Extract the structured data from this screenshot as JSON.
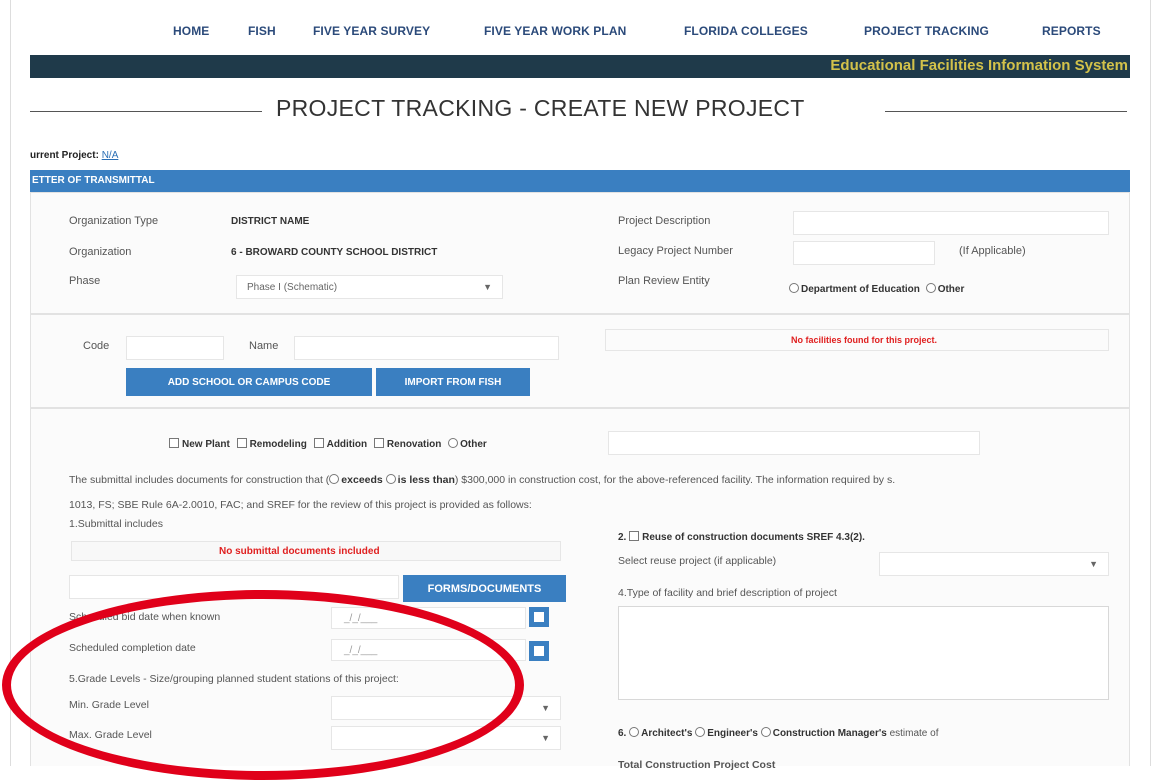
{
  "nav": {
    "items": [
      "HOME",
      "FISH",
      "FIVE YEAR SURVEY",
      "FIVE YEAR WORK PLAN",
      "FLORIDA COLLEGES",
      "PROJECT TRACKING",
      "REPORTS"
    ]
  },
  "banner": {
    "text": "Educational Facilities Information System"
  },
  "page": {
    "title": "PROJECT TRACKING - CREATE NEW PROJECT"
  },
  "current_project": {
    "label": "urrent Project:",
    "value": "N/A"
  },
  "section": {
    "title": "ETTER OF TRANSMITTAL"
  },
  "org": {
    "type_label": "Organization Type",
    "type_value": "DISTRICT NAME",
    "org_label": "Organization",
    "org_value": "6 - BROWARD COUNTY SCHOOL DISTRICT",
    "phase_label": "Phase",
    "phase_value": "Phase I (Schematic)",
    "desc_label": "Project Description",
    "legacy_label": "Legacy Project Number",
    "legacy_hint": "(If Applicable)",
    "review_label": "Plan Review Entity",
    "review_options": [
      "Department of Education",
      "Other"
    ]
  },
  "facility": {
    "code_label": "Code",
    "name_label": "Name",
    "add_button": "ADD SCHOOL OR CAMPUS CODE",
    "import_button": "IMPORT FROM FISH",
    "empty_message": "No facilities found for this project."
  },
  "construction": {
    "types": [
      "New Plant",
      "Remodeling",
      "Addition",
      "Renovation",
      "Other"
    ],
    "text_prefix": "The submittal includes documents for construction that (",
    "exceeds": "exceeds",
    "less_than": "is less than",
    "text_suffix": ") $300,000 in construction cost, for the above-referenced facility. The information required by s.",
    "text_line2": "1013, FS; SBE Rule 6A-2.0010, FAC; and SREF for the review of this project is provided as follows:"
  },
  "submittal": {
    "label": "1.Submittal includes",
    "empty": "No submittal documents included",
    "forms_button": "FORMS/DOCUMENTS",
    "bid_label": "Scheduled bid date when known",
    "completion_label": "Scheduled completion date",
    "date_placeholder": "_/_/___",
    "grade_label": "5.Grade Levels - Size/grouping planned student stations of this project:",
    "min_grade_label": "Min. Grade Level",
    "max_grade_label": "Max. Grade Level"
  },
  "reuse": {
    "number": "2.",
    "label": "Reuse of construction documents SREF 4.3(2).",
    "select_label": "Select reuse project (if applicable)"
  },
  "facility_type": {
    "label": "4.Type of facility and brief description of project"
  },
  "estimate": {
    "number": "6.",
    "options": [
      "Architect's",
      "Engineer's",
      "Construction Manager's"
    ],
    "suffix": "estimate of",
    "total_label": "Total Construction Project Cost"
  }
}
